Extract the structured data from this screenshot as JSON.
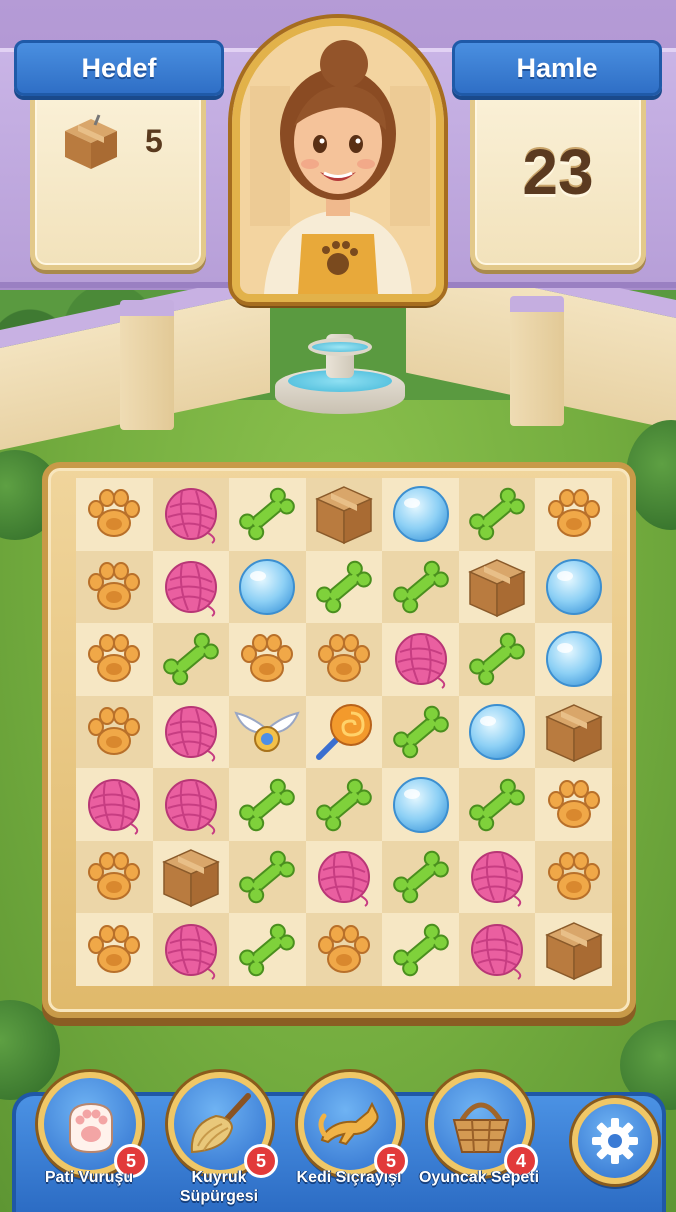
{
  "hud": {
    "goal": {
      "title": "Hedef",
      "item_icon": "cardboard-box-icon",
      "count": "5"
    },
    "moves": {
      "title": "Hamle",
      "count": "23"
    },
    "character": "cat-cafe-owner-portrait"
  },
  "board": {
    "rows": 7,
    "cols": 7,
    "tiles": [
      [
        "paw",
        "yarn",
        "bone",
        "box",
        "bubble",
        "bone",
        "paw"
      ],
      [
        "paw",
        "yarn",
        "bubble",
        "bone",
        "bone",
        "box",
        "bubble"
      ],
      [
        "paw",
        "bone",
        "paw",
        "paw",
        "yarn",
        "bone",
        "bubble"
      ],
      [
        "paw",
        "yarn",
        "wing-charm",
        "whistle",
        "bone",
        "bubble",
        "box"
      ],
      [
        "yarn",
        "yarn",
        "bone",
        "bone",
        "bubble",
        "bone",
        "paw"
      ],
      [
        "paw",
        "box",
        "bone",
        "yarn",
        "bone",
        "yarn",
        "paw"
      ],
      [
        "paw",
        "yarn",
        "bone",
        "paw",
        "bone",
        "yarn",
        "box"
      ]
    ]
  },
  "boosters": [
    {
      "label": "Pati Vuruşu",
      "count": "5",
      "icon": "paw-glove-icon"
    },
    {
      "label": "Kuyruk Süpürgesi",
      "count": "5",
      "icon": "feather-duster-icon"
    },
    {
      "label": "Kedi Sıçrayışı",
      "count": "5",
      "icon": "jumping-cat-icon"
    },
    {
      "label": "Oyuncak Sepeti",
      "count": "4",
      "icon": "basket-icon"
    }
  ],
  "settings_icon": "gear-icon",
  "colors": {
    "ribbon_blue": "#2f6fc6",
    "badge_red": "#e23a3a",
    "frame_gold": "#e2b24a"
  }
}
